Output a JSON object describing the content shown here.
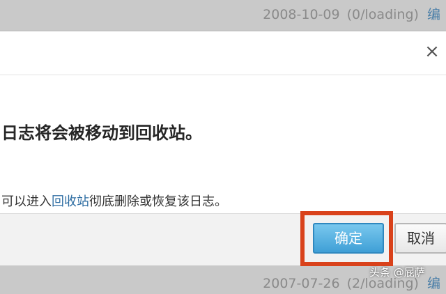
{
  "background": {
    "top_row": {
      "date": "2008-10-09",
      "status": "(0/loading)",
      "truncated_link": "编"
    },
    "bottom_row": {
      "date": "2007-07-26",
      "status": "(2/loading)",
      "truncated_link": "编"
    }
  },
  "dialog": {
    "close_glyph": "×",
    "headline": "日志将会被移动到回收站。",
    "subtext_before": "可以进入",
    "subtext_link": "回收站",
    "subtext_after": "彻底删除或恢复该日志。"
  },
  "buttons": {
    "confirm_label": "确定",
    "cancel_label": "取消"
  },
  "watermark": "头条 @屁萨",
  "colors": {
    "highlight": "#d9421b",
    "confirm_button": "#4aa8dd",
    "link": "#2f6ea3"
  }
}
